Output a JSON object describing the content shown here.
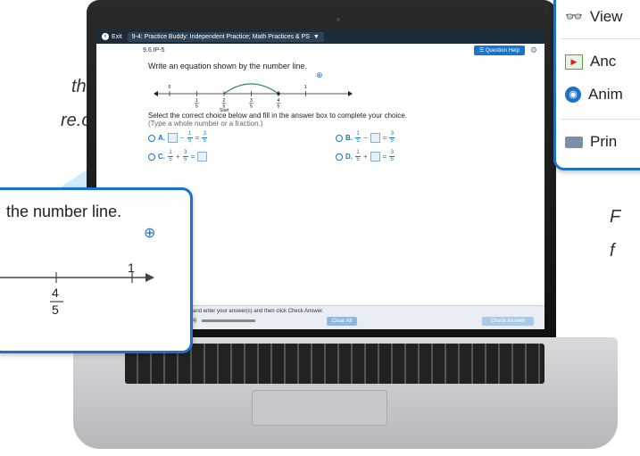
{
  "side_text": {
    "line1": "th",
    "line2": "re.com.",
    "line3": "F",
    "line4": "f"
  },
  "app": {
    "exit_label": "Exit",
    "assignment_title": "9-4: Practice Buddy: Independent Practice; Math Practices & PS",
    "question_id": "9.6.IP-5",
    "question_help_label": "Question Help",
    "prompt": "Write an equation shown by the number line.",
    "number_line": {
      "start_label": "Start",
      "ticks": [
        "0",
        "1/5",
        "2/5",
        "3/5",
        "4/5",
        "1"
      ],
      "arc_from": 1,
      "arc_to": 3
    },
    "choices_instruction": "Select the correct choice below and fill in the answer box to complete your choice.",
    "choices_hint": "(Type a whole number or a fraction.)",
    "choices": [
      {
        "letter": "A.",
        "parts": [
          "box",
          "−",
          "1/5",
          "=",
          "3/5"
        ]
      },
      {
        "letter": "B.",
        "parts": [
          "1/5",
          "−",
          "box",
          "=",
          "3/5"
        ]
      },
      {
        "letter": "C.",
        "parts": [
          "1/5",
          "+",
          "3/5",
          "=",
          "box"
        ]
      },
      {
        "letter": "D.",
        "parts": [
          "1/5",
          "+",
          "box",
          "=",
          "3/5"
        ]
      }
    ],
    "bottom_message": "and enter your answer(s) and then click Check Answer.",
    "bottom_fragment": "ing",
    "clear_label": "Clear All",
    "check_label": "Check Answer"
  },
  "zoom_left": {
    "text": "the number line.",
    "tick_4": "4",
    "tick_5": "5",
    "tick_1": "1"
  },
  "zoom_right": {
    "items": [
      "View",
      "Anc",
      "Anim",
      "Prin"
    ]
  },
  "colors": {
    "accent": "#1a73c9",
    "beam": "#78c8f0"
  }
}
